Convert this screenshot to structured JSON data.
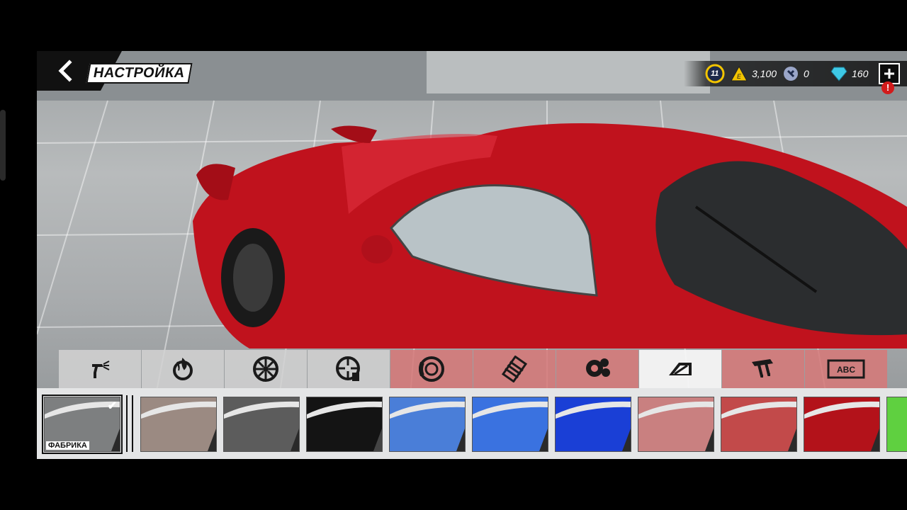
{
  "header": {
    "title": "НАСТРОЙКА",
    "back_icon": "chevron-left-icon"
  },
  "currencies": [
    {
      "name": "level",
      "icon": "level-badge-icon",
      "value": "11"
    },
    {
      "name": "energy",
      "icon": "energy-icon",
      "value": "3,100"
    },
    {
      "name": "parts",
      "icon": "wrench-icon",
      "value": "0"
    },
    {
      "name": "gems",
      "icon": "diamond-icon",
      "value": "160"
    }
  ],
  "add_button": {
    "icon": "plus-icon",
    "alert": "!"
  },
  "toolbar": {
    "items": [
      {
        "icon": "paint-gun-icon",
        "tint": "gray"
      },
      {
        "icon": "paint-flame-icon",
        "tint": "gray"
      },
      {
        "icon": "wheel-icon",
        "tint": "gray"
      },
      {
        "icon": "wheel-paint-icon",
        "tint": "gray"
      },
      {
        "icon": "brake-disc-icon",
        "tint": "red"
      },
      {
        "icon": "spring-icon",
        "tint": "red"
      },
      {
        "icon": "smoke-icon",
        "tint": "red"
      },
      {
        "icon": "window-tint-icon",
        "tint": "active"
      },
      {
        "icon": "spoiler-icon",
        "tint": "red"
      },
      {
        "icon": "license-plate-icon",
        "tint": "red",
        "text": "ABC"
      }
    ]
  },
  "swatches": [
    {
      "label": "ФАБРИКА",
      "color": "#7d7f80",
      "selected": true
    },
    {
      "color": "#9b8a82"
    },
    {
      "color": "#5c5c5c"
    },
    {
      "color": "#141414"
    },
    {
      "color": "#4a7ed8"
    },
    {
      "color": "#3a72e0"
    },
    {
      "color": "#1a3fd6"
    },
    {
      "color": "#c98080"
    },
    {
      "color": "#c24a4a"
    },
    {
      "color": "#b3121a"
    },
    {
      "color": "#5fd040"
    }
  ],
  "colors": {
    "accent": "#d21b1b",
    "energy": "#f2c400",
    "level": "#f2c400",
    "gem": "#3ec9e6"
  }
}
